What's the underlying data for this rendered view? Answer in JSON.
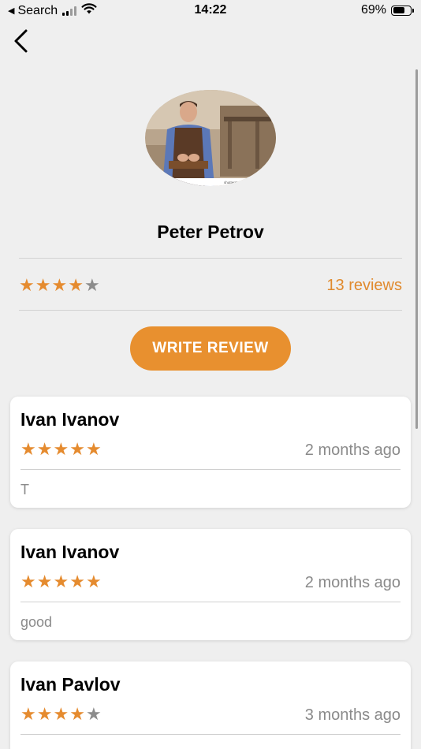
{
  "status_bar": {
    "back_app": "Search",
    "time": "14:22",
    "battery": "69%",
    "battery_level": 0.69
  },
  "profile": {
    "name": "Peter Petrov",
    "avatar": "carpenter-photo",
    "rating": 4,
    "max_rating": 5,
    "reviews_count_label": "13 reviews",
    "photo_watermark": "shutterstock.com · 415849744"
  },
  "actions": {
    "write_review_label": "WRITE REVIEW"
  },
  "colors": {
    "accent": "#e8902f",
    "star_on": "#e58b2f",
    "star_off": "#8c8c8c",
    "background": "#efefef"
  },
  "reviews": [
    {
      "author": "Ivan Ivanov",
      "rating": 5,
      "date": "2 months ago",
      "comment": "T"
    },
    {
      "author": "Ivan Ivanov",
      "rating": 5,
      "date": "2 months ago",
      "comment": "good"
    },
    {
      "author": "Ivan Pavlov",
      "rating": 4,
      "date": "3 months ago",
      "comment": ""
    }
  ],
  "icons": {
    "back": "chevron-left-icon",
    "signal": "cellular-signal-icon",
    "wifi": "wifi-icon",
    "battery": "battery-icon",
    "star": "star-icon"
  }
}
